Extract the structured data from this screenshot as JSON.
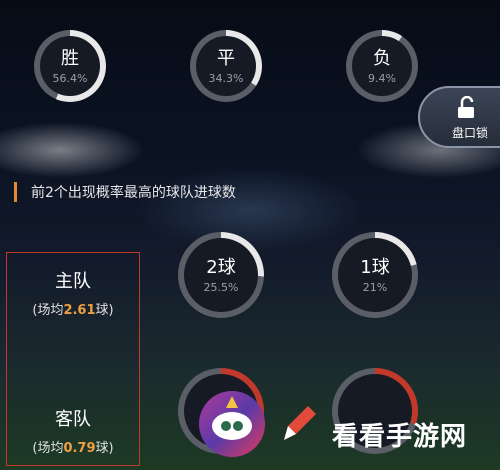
{
  "odds": [
    {
      "label": "胜",
      "percent": "56.4%",
      "value": 56.4,
      "color": "#e8e8e8"
    },
    {
      "label": "平",
      "percent": "34.3%",
      "value": 34.3,
      "color": "#e8e8e8"
    },
    {
      "label": "负",
      "percent": "9.4%",
      "value": 9.4,
      "color": "#e8e8e8"
    }
  ],
  "lock": {
    "label": "盘口锁",
    "icon": "unlock-icon"
  },
  "section": {
    "title": "前2个出现概率最高的球队进球数"
  },
  "home": {
    "name": "主队",
    "avg_prefix": "(场均",
    "avg_value": "2.61",
    "avg_suffix": "球)",
    "goals": [
      {
        "label": "2球",
        "percent": "25.5%",
        "value": 25.5,
        "color": "#e8e8e8"
      },
      {
        "label": "1球",
        "percent": "21%",
        "value": 21,
        "color": "#e8e8e8"
      }
    ]
  },
  "away": {
    "name": "客队",
    "avg_prefix": "(场均",
    "avg_value": "0.79",
    "avg_suffix": "球)",
    "goals_colors": [
      "#c0392b",
      "#c0392b"
    ]
  },
  "watermark": {
    "text": "看看手游网"
  },
  "colors": {
    "accent": "#e28a2f",
    "highlight": "#f0a040",
    "border": "#c0392b"
  }
}
